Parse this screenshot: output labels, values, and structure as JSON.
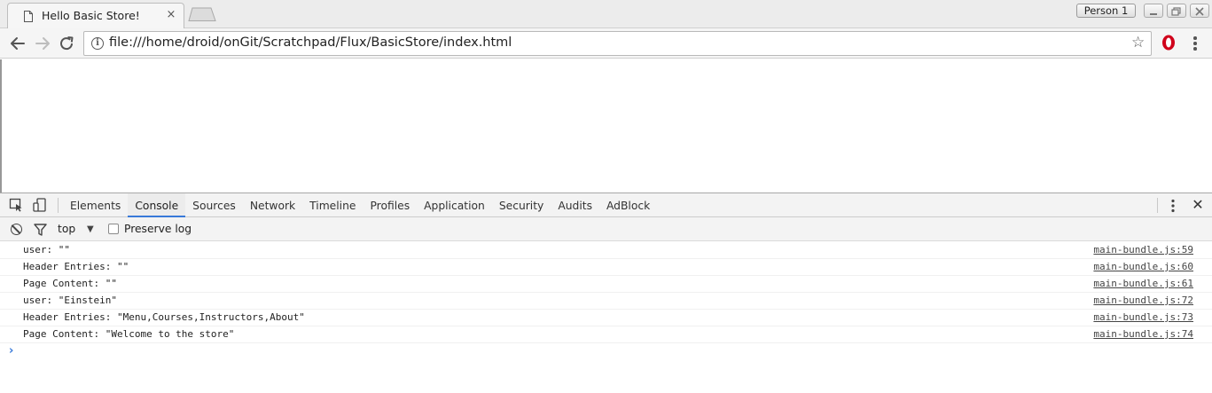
{
  "browser": {
    "tab": {
      "title": "Hello Basic Store!",
      "close_symbol": "×"
    },
    "profile_label": "Person 1",
    "url": "file:///home/droid/onGit/Scratchpad/Flux/BasicStore/index.html"
  },
  "devtools": {
    "tabs": [
      "Elements",
      "Console",
      "Sources",
      "Network",
      "Timeline",
      "Profiles",
      "Application",
      "Security",
      "Audits",
      "AdBlock"
    ],
    "active_tab": "Console",
    "close_symbol": "✕",
    "console_toolbar": {
      "context": "top",
      "caret": "▼",
      "preserve_log_label": "Preserve log",
      "preserve_log_checked": false
    },
    "console": {
      "entries": [
        {
          "message": "user: \"\"",
          "source": "main-bundle.js:59"
        },
        {
          "message": "Header Entries: \"\"",
          "source": "main-bundle.js:60"
        },
        {
          "message": "Page Content: \"\"",
          "source": "main-bundle.js:61"
        },
        {
          "message": "user: \"Einstein\"",
          "source": "main-bundle.js:72"
        },
        {
          "message": "Header Entries: \"Menu,Courses,Instructors,About\"",
          "source": "main-bundle.js:73"
        },
        {
          "message": "Page Content: \"Welcome to the store\"",
          "source": "main-bundle.js:74"
        }
      ],
      "prompt_symbol": "›"
    }
  },
  "colors": {
    "devtools_accent": "#3879d9",
    "extension_red": "#d0021b"
  }
}
